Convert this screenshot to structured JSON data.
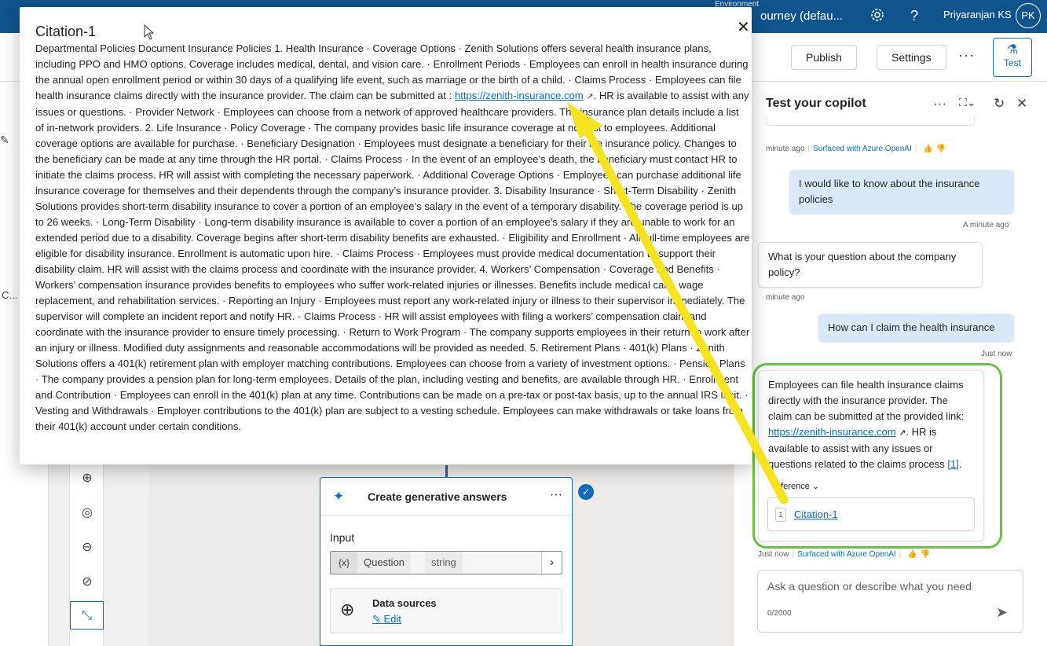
{
  "topbar": {
    "env_label": "Environment",
    "env_name": "ourney (defau...",
    "user_name": "Priyaranjan KS",
    "avatar_initials": "PK",
    "settings_icon": "gear-icon",
    "help_icon": "question-icon",
    "help_glyph": "?"
  },
  "cmdbar": {
    "publish_label": "Publish",
    "settings_label": "Settings",
    "more_glyph": "···",
    "test_label": "Test"
  },
  "leftnav": {
    "truncated_label": "C..."
  },
  "canvas": {
    "node_title": "Create generative answers",
    "node_more": "···",
    "input_label": "Input",
    "input_var": "{x}",
    "input_name": "Question",
    "input_type": "string",
    "datasource_title": "Data sources",
    "datasource_edit": "Edit"
  },
  "test_panel": {
    "title": "Test your copilot",
    "meta1_time": "minute ago",
    "surfaced_label": "Surfaced with Azure OpenAI",
    "user_msg1": "I would like to know about the insurance policies",
    "user_msg1_time": "A minute ago",
    "bot_msg1": "What is your question about the company policy?",
    "bot_msg1_time": "minute ago",
    "user_msg2": "How can I claim the health insurance",
    "user_msg2_time": "Just now",
    "bot_msg2_before": "Employees can file health insurance claims directly with the insurance provider. The claim can be submitted at the provided link: ",
    "bot_msg2_link": "https://zenith-insurance.com",
    "bot_msg2_after": ". HR is available to assist with any issues or questions related to the claims process ",
    "bot_msg2_ref": "[1]",
    "bot_msg2_end": ".",
    "reference_toggle": "eference",
    "citation_num": "1",
    "citation_label": "Citation-1",
    "bot_msg2_time": "Just now",
    "composer_placeholder": "Ask a question or describe what you need",
    "char_count": "0/2000"
  },
  "modal": {
    "title": "Citation-1",
    "body_before": "Departmental Policies Document Insurance Policies 1. Health Insurance · Coverage Options · Zenith Solutions offers several health insurance plans, including PPO and HMO options. Coverage includes medical, dental, and vision care. · Enrollment Periods · Employees can enroll in health insurance during the annual open enrollment period or within 30 days of a qualifying life event, such as marriage or the birth of a child. · Claims Process · Employees can file health insurance claims directly with the insurance provider. The claim can be submitted at : ",
    "body_link": "https://zenith-insurance.com",
    "body_after": ". HR is available to assist with any issues or questions. · Provider Network · Employees can choose from a network of approved healthcare providers. The insurance plan details include a list of in-network providers. 2. Life Insurance · Policy Coverage · The company provides basic life insurance coverage at no cost to employees. Additional coverage options are available for purchase. · Beneficiary Designation · Employees must designate a beneficiary for their life insurance policy. Changes to the beneficiary can be made at any time through the HR portal. · Claims Process · In the event of an employee’s death, the beneficiary must contact HR to initiate the claims process. HR will assist with completing the necessary paperwork. · Additional Coverage Options · Employees can purchase additional life insurance coverage for themselves and their dependents through the company’s insurance provider. 3. Disability Insurance · Short-Term Disability · Zenith Solutions provides short-term disability insurance to cover a portion of an employee’s salary in the event of a temporary disability. The coverage period is up to 26 weeks. · Long-Term Disability · Long-term disability insurance is available to cover a portion of an employee’s salary if they are unable to work for an extended period due to a disability. Coverage begins after short-term disability benefits are exhausted. · Eligibility and Enrollment · All full-time employees are eligible for disability insurance. Enrollment is automatic upon hire. · Claims Process · Employees must provide medical documentation to support their disability claim. HR will assist with the claims process and coordinate with the insurance provider. 4. Workers’ Compensation · Coverage and Benefits · Workers’ compensation insurance provides benefits to employees who suffer work-related injuries or illnesses. Benefits include medical care, wage replacement, and rehabilitation services. · Reporting an Injury · Employees must report any work-related injury or illness to their supervisor immediately. The supervisor will complete an incident report and notify HR. · Claims Process · HR will assist employees with filing a workers’ compensation claim and coordinate with the insurance provider to ensure timely processing. · Return to Work Program · The company supports employees in their return to work after an injury or illness. Modified duty assignments and reasonable accommodations will be provided as needed. 5. Retirement Plans · 401(k) Plans · Zenith Solutions offers a 401(k) retirement plan with employer matching contributions. Employees can choose from a variety of investment options. · Pension Plans · The company provides a pension plan for long-term employees. Details of the plan, including vesting and benefits, are available through HR. · Enrollment and Contribution · Employees can enroll in the 401(k) plan at any time. Contributions can be made on a pre-tax or post-tax basis, up to the annual IRS limit. · Vesting and Withdrawals · Employer contributions to the 401(k) plan are subject to a vesting schedule. Employees can make withdrawals or take loans from their 401(k) account under certain conditions."
  },
  "colors": {
    "brand_bar": "#0f548c",
    "accent": "#0f6cbd",
    "highlight_box": "#6cc04a",
    "annotation_arrow": "#f7e221"
  }
}
